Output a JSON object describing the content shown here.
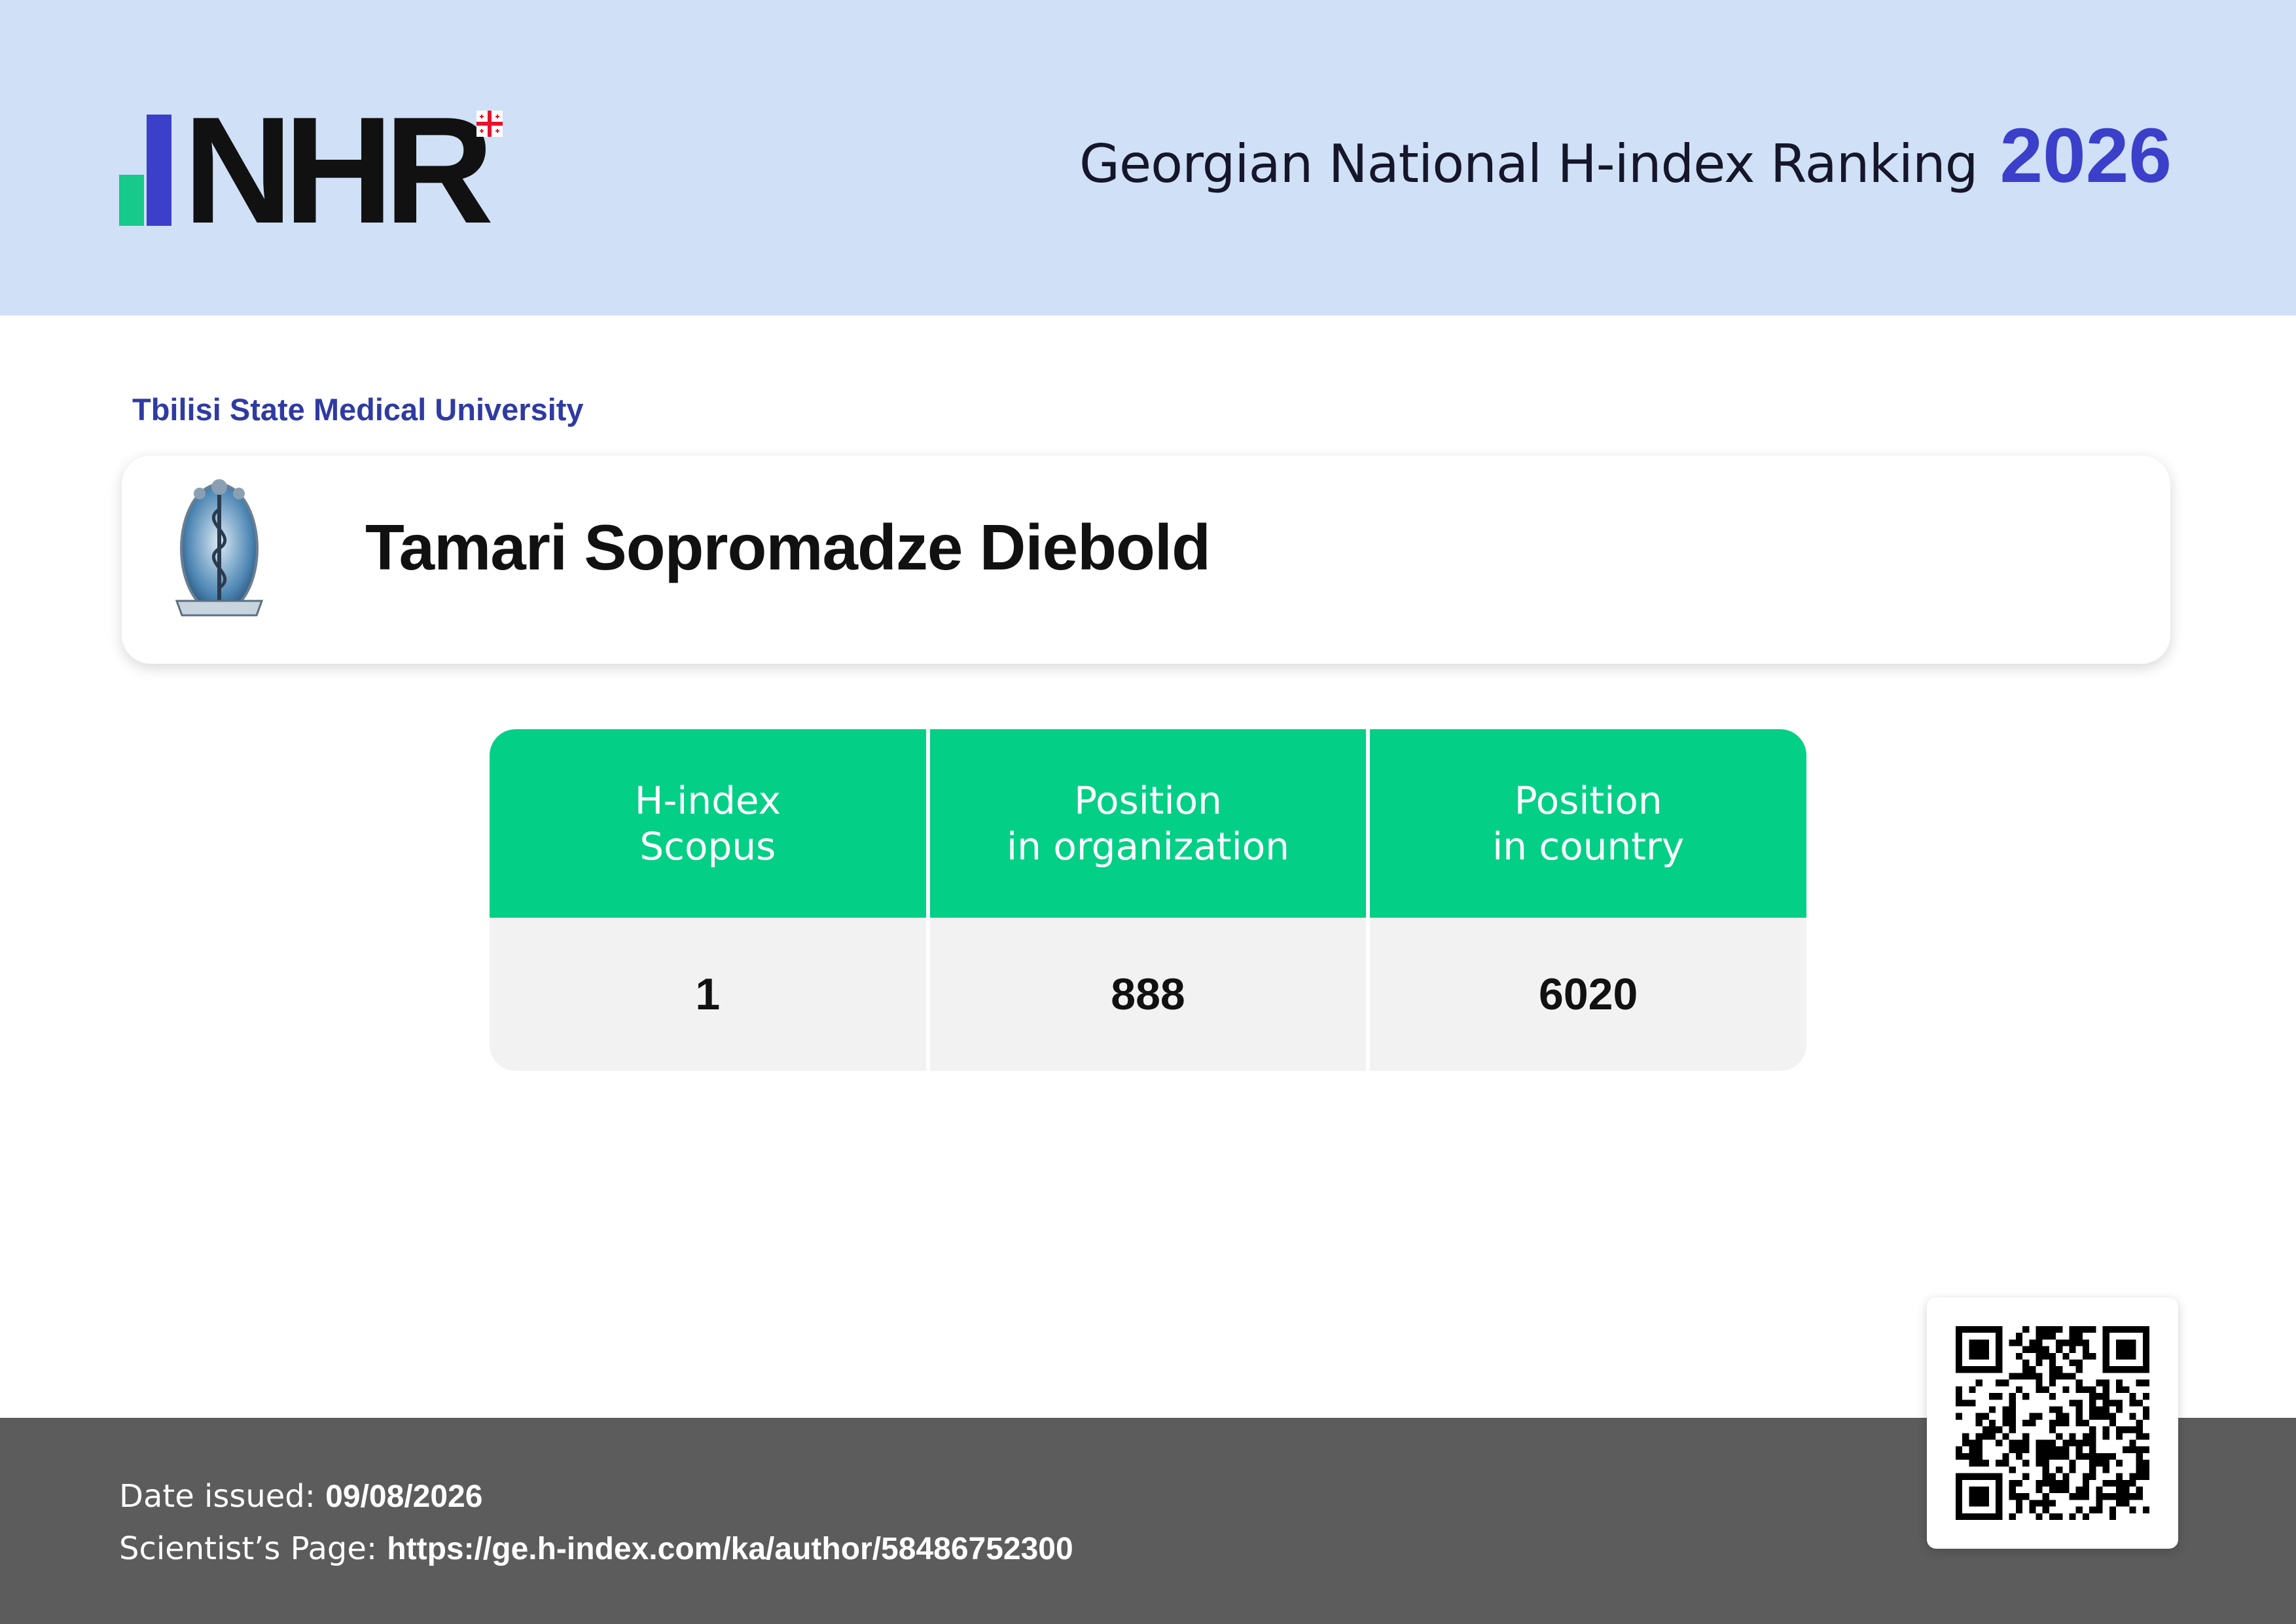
{
  "header": {
    "logo_text": "NHR",
    "title": "Georgian National H-index Ranking",
    "year": "2026"
  },
  "organization": {
    "name": "Tbilisi State Medical University"
  },
  "person": {
    "name": "Tamari Sopromadze Diebold"
  },
  "stats": {
    "columns": [
      {
        "label_line1": "H-index",
        "label_line2": "Scopus",
        "value": "1"
      },
      {
        "label_line1": "Position",
        "label_line2": "in organization",
        "value": "888"
      },
      {
        "label_line1": "Position",
        "label_line2": "in country",
        "value": "6020"
      }
    ]
  },
  "footer": {
    "date_label": "Date issued:",
    "date_value": "09/08/2026",
    "page_label": "Scientist’s Page:",
    "page_url": "https://ge.h-index.com/ka/author/58486752300"
  },
  "colors": {
    "header_bg": "#cfe0f7",
    "accent_blue": "#3b3fc9",
    "accent_green": "#04cf86",
    "footer_bg": "#5c5c5c"
  }
}
